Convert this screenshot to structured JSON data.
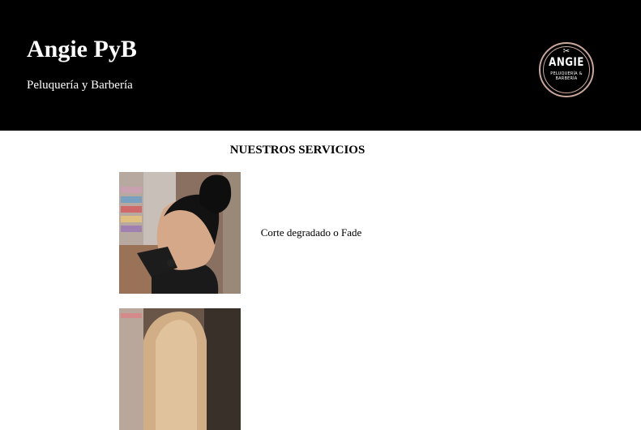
{
  "header": {
    "title": "Angie PyB",
    "subtitle": "Peluquería y Barbería",
    "logo": {
      "name": "ANGIE",
      "tagline": "PELUQUERÍA & BARBERÍA",
      "icon": "scissors-icon"
    }
  },
  "services": {
    "heading": "NUESTROS SERVICIOS",
    "items": [
      {
        "label": "Corte degradado o Fade",
        "image": "fade-haircut-photo"
      },
      {
        "label": "",
        "image": "blonde-hair-photo"
      }
    ]
  },
  "colors": {
    "header_bg": "#000000",
    "logo_ring": "#c9a79a"
  }
}
